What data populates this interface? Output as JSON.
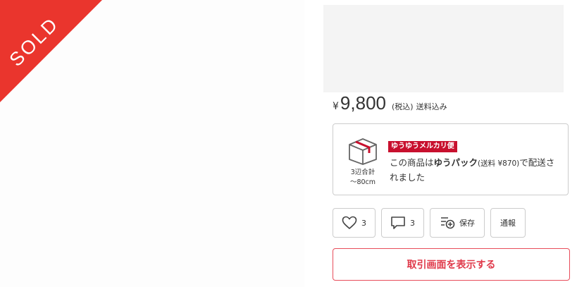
{
  "sold_label": "SOLD",
  "price": {
    "currency": "¥",
    "amount": "9,800",
    "tax_note": "(税込)",
    "shipping_note": "送料込み"
  },
  "shipping": {
    "size_line1": "3辺合計",
    "size_line2": "〜80cm",
    "method_badge": "ゆうゆうメルカリ便",
    "desc_prefix": "この商品は",
    "desc_method": "ゆうパック",
    "desc_fee": "(送料 ¥870)",
    "desc_suffix": "で配送されました"
  },
  "actions": {
    "like_count": "3",
    "comment_count": "3",
    "save_label": "保存",
    "report_label": "通報"
  },
  "primary_button": "取引画面を表示する",
  "colors": {
    "sold_red": "#ea352d",
    "brand_red": "#c8102e",
    "button_text": "#e03a4b"
  }
}
